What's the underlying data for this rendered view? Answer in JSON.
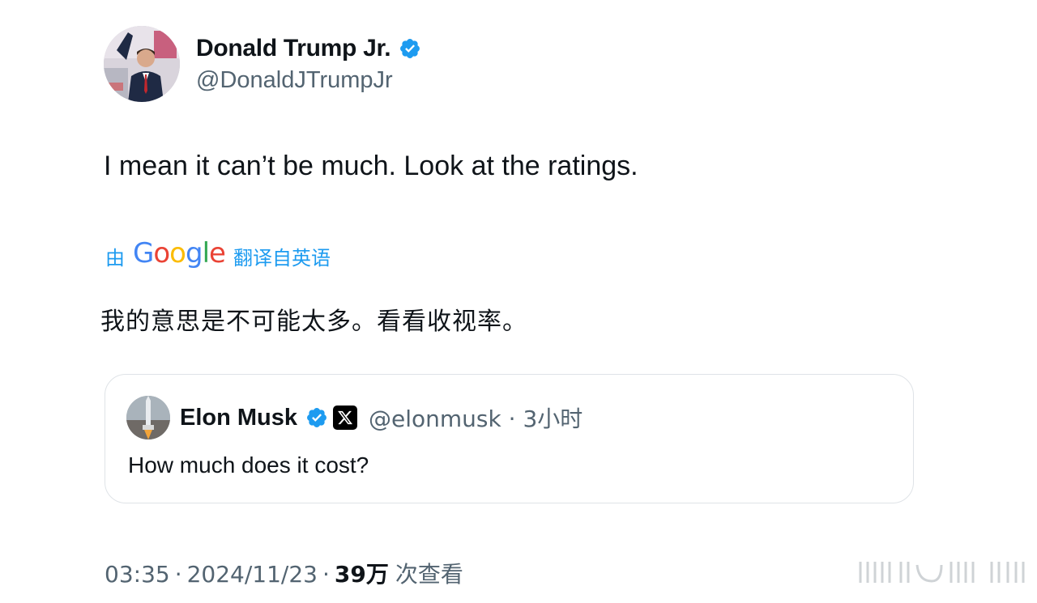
{
  "author": {
    "display_name": "Donald Trump Jr.",
    "handle": "@DonaldJTrumpJr",
    "verified": true,
    "verified_color": "#1d9bf0"
  },
  "tweet": {
    "text_en": "I mean it can’t be much. Look at the ratings.",
    "translation": {
      "prefix": "由",
      "provider": "Google",
      "suffix": "翻译自英语"
    },
    "text_zh": "我的意思是不可能太多。看看收视率。"
  },
  "quoted_tweet": {
    "display_name": "Elon Musk",
    "verified": true,
    "affiliate_badge": "x-logo-icon",
    "handle": "@elonmusk",
    "time": "3小时",
    "text": "How much does it cost?"
  },
  "footer": {
    "time": "03:35",
    "date": "2024/11/23",
    "views_count": "39万",
    "views_label": "次查看"
  },
  "colors": {
    "text": "#0f1419",
    "secondary": "#536471",
    "accent": "#1d9bf0",
    "border": "#dfe3e7"
  }
}
